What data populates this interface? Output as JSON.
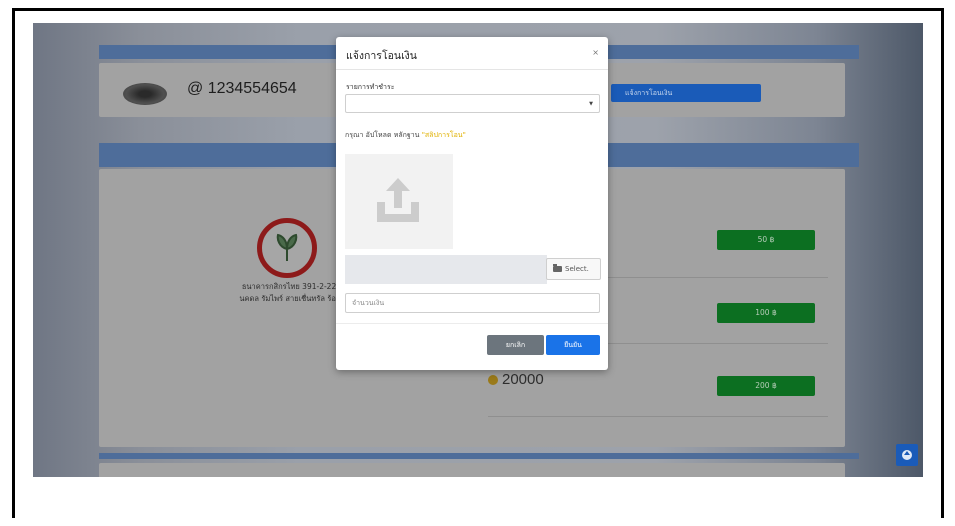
{
  "background": {
    "username": "@ 1234554654",
    "notify_button": "แจ้งการโอนเงิน",
    "bank_name": "ธนาคารกสิกรไทย 391-2-222",
    "account_name": "นคดล รัมไพร์ สายเชื่นทรัล ร้อน",
    "topup_options": [
      "50 ฿",
      "100 ฿",
      "200 ฿"
    ],
    "coin_amount": "20000"
  },
  "modal": {
    "title": "แจ้งการโอนเงิน",
    "close": "×",
    "payment_label": "รายการทำชำระ",
    "upload_hint_prefix": "กรุณา อัปโหลด หลักฐาน ",
    "upload_hint_highlight": "\"สลิปการโอน\"",
    "file_button": "Select.",
    "amount_placeholder": "จำนวนเงิน",
    "cancel": "ยกเลิก",
    "confirm": "ยืนยัน"
  },
  "colors": {
    "primary": "#1a73e8",
    "secondary": "#6c757d",
    "highlight": "#e0b100",
    "success": "#0c6f21"
  },
  "icons": {
    "upload": "upload-icon",
    "folder": "folder-icon",
    "arrow_up": "arrow-up-circle-icon"
  }
}
